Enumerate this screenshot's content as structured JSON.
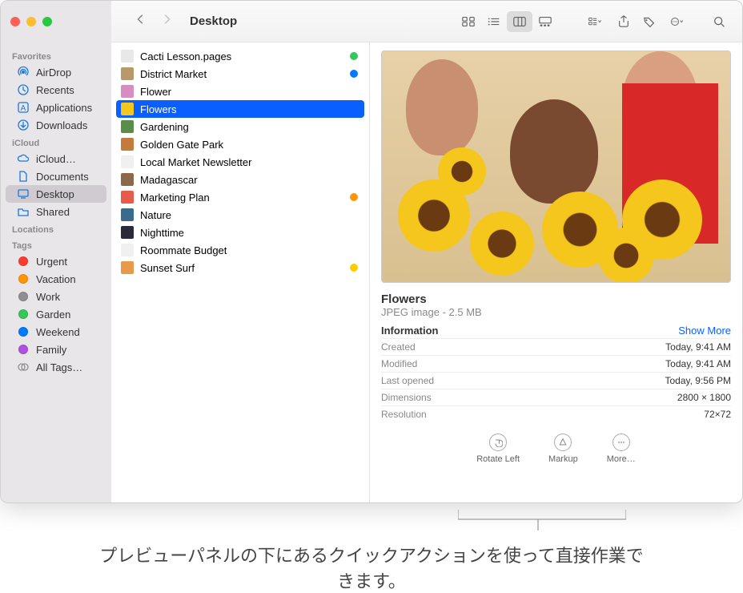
{
  "window_title": "Desktop",
  "sidebar": {
    "sections": [
      {
        "header": "Favorites",
        "items": [
          {
            "label": "AirDrop",
            "icon": "airdrop"
          },
          {
            "label": "Recents",
            "icon": "clock"
          },
          {
            "label": "Applications",
            "icon": "apps"
          },
          {
            "label": "Downloads",
            "icon": "download"
          }
        ]
      },
      {
        "header": "iCloud",
        "items": [
          {
            "label": "iCloud…",
            "icon": "cloud"
          },
          {
            "label": "Documents",
            "icon": "doc"
          },
          {
            "label": "Desktop",
            "icon": "desktop",
            "selected": true
          },
          {
            "label": "Shared",
            "icon": "shared"
          }
        ]
      },
      {
        "header": "Locations",
        "items": []
      },
      {
        "header": "Tags",
        "items": [
          {
            "label": "Urgent",
            "color": "#ff3b30"
          },
          {
            "label": "Vacation",
            "color": "#ff9500"
          },
          {
            "label": "Work",
            "color": "#8e8e93"
          },
          {
            "label": "Garden",
            "color": "#34c759"
          },
          {
            "label": "Weekend",
            "color": "#007aff"
          },
          {
            "label": "Family",
            "color": "#af52de"
          },
          {
            "label": "All Tags…",
            "color": null
          }
        ]
      }
    ]
  },
  "files": [
    {
      "name": "Cacti Lesson.pages",
      "tag": "#34c759",
      "thumb": "#e8e8e8"
    },
    {
      "name": "District Market",
      "tag": "#007aff",
      "thumb": "#b89a6a"
    },
    {
      "name": "Flower",
      "thumb": "#d98cc4"
    },
    {
      "name": "Flowers",
      "selected": true,
      "thumb": "#f5c61b"
    },
    {
      "name": "Gardening",
      "thumb": "#5a8c4a"
    },
    {
      "name": "Golden Gate Park",
      "thumb": "#c47a3a"
    },
    {
      "name": "Local Market Newsletter",
      "thumb": "#f0f0f0"
    },
    {
      "name": "Madagascar",
      "thumb": "#8a6a4a"
    },
    {
      "name": "Marketing Plan",
      "tag": "#ff9500",
      "thumb": "#e85a4a"
    },
    {
      "name": "Nature",
      "thumb": "#3a6a8c"
    },
    {
      "name": "Nighttime",
      "thumb": "#2a2a3a"
    },
    {
      "name": "Roommate Budget",
      "thumb": "#f0f0f0"
    },
    {
      "name": "Sunset Surf",
      "tag": "#ffcc00",
      "thumb": "#e89a4a"
    }
  ],
  "preview": {
    "title": "Flowers",
    "subtitle": "JPEG image - 2.5 MB",
    "info_header": "Information",
    "show_more": "Show More",
    "rows": [
      {
        "k": "Created",
        "v": "Today, 9:41 AM"
      },
      {
        "k": "Modified",
        "v": "Today, 9:41 AM"
      },
      {
        "k": "Last opened",
        "v": "Today, 9:56 PM"
      },
      {
        "k": "Dimensions",
        "v": "2800 × 1800"
      },
      {
        "k": "Resolution",
        "v": "72×72"
      }
    ],
    "quick_actions": [
      {
        "label": "Rotate Left",
        "icon": "rotate"
      },
      {
        "label": "Markup",
        "icon": "markup"
      },
      {
        "label": "More…",
        "icon": "more"
      }
    ]
  },
  "caption": "プレビューパネルの下にあるクイックアクションを使って直接作業できます。"
}
